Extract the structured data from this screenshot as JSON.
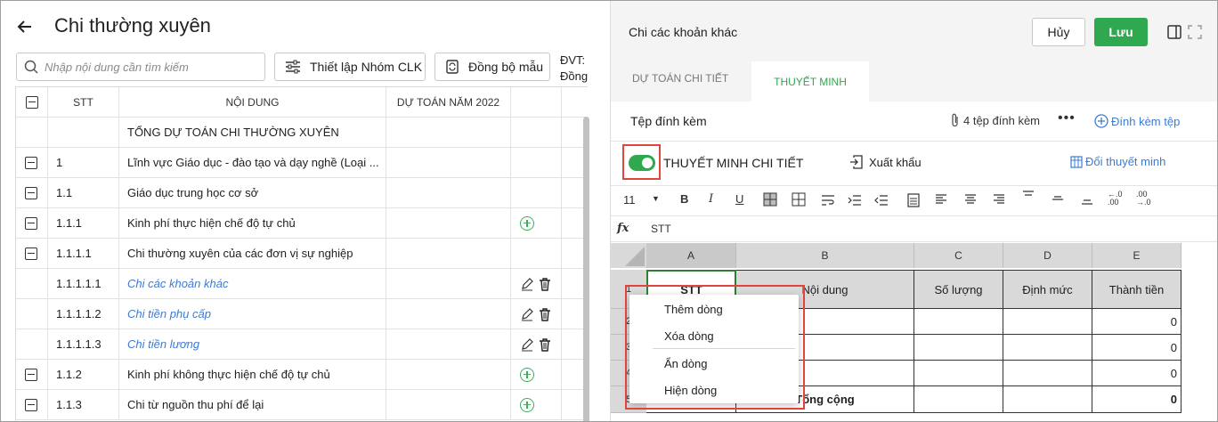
{
  "left": {
    "title": "Chi thường xuyên",
    "search_placeholder": "Nhập nội dung cần tìm kiếm",
    "setup_group_btn": "Thiết lập Nhóm CLK",
    "sync_template_btn": "Đồng bộ mẫu",
    "unit_line1": "ĐVT:",
    "unit_line2": "Đồng",
    "columns": {
      "stt": "STT",
      "content": "NỘI DUNG",
      "budget": "DỰ TOÁN NĂM 2022"
    },
    "rows": [
      {
        "stt": "",
        "content": "TỔNG DỰ TOÁN CHI THƯỜNG XUYÊN",
        "check": false,
        "style": "plain",
        "action": "none"
      },
      {
        "stt": "1",
        "content": "Lĩnh vực Giáo dục - đào tạo và dạy nghề (Loại ...",
        "check": true,
        "style": "plain",
        "action": "none"
      },
      {
        "stt": "1.1",
        "content": "Giáo dục trung học cơ sở",
        "check": true,
        "style": "plain",
        "action": "none"
      },
      {
        "stt": "1.1.1",
        "content": "Kinh phí thực hiện chế độ tự chủ",
        "check": true,
        "style": "plain",
        "action": "add"
      },
      {
        "stt": "1.1.1.1",
        "content": "Chi thường xuyên của các đơn vị sự nghiệp",
        "check": true,
        "style": "plain",
        "action": "none"
      },
      {
        "stt": "1.1.1.1.1",
        "content": "Chi các khoản khác",
        "check": false,
        "style": "link",
        "action": "edit"
      },
      {
        "stt": "1.1.1.1.2",
        "content": "Chi tiền phụ cấp",
        "check": false,
        "style": "link",
        "action": "edit"
      },
      {
        "stt": "1.1.1.1.3",
        "content": "Chi tiền lương",
        "check": false,
        "style": "link",
        "action": "edit"
      },
      {
        "stt": "1.1.2",
        "content": "Kinh phí không thực hiện chế độ tự chủ",
        "check": true,
        "style": "plain",
        "action": "add"
      },
      {
        "stt": "1.1.3",
        "content": "Chi từ nguồn thu phí để lại",
        "check": true,
        "style": "plain",
        "action": "add"
      }
    ]
  },
  "right": {
    "title": "Chi các khoản khác",
    "cancel": "Hủy",
    "save": "Lưu",
    "tabs": [
      "DỰ TOÁN CHI TIẾT",
      "THUYẾT MINH"
    ],
    "active_tab": 1,
    "attach_label": "Tệp đính kèm",
    "attach_count": "4 tệp đính kèm",
    "attach_add": "Đính kèm tệp",
    "detail_label": "THUYẾT MINH CHI TIẾT",
    "detail_enabled": true,
    "export": "Xuất khẩu",
    "change": "Đổi thuyết minh",
    "font_size": "11",
    "formula_value": "STT",
    "sheet": {
      "col_letters": [
        "A",
        "B",
        "C",
        "D",
        "E"
      ],
      "headers": [
        "STT",
        "Nội dung",
        "Số lượng",
        "Định mức",
        "Thành tiền"
      ],
      "row_numbers": [
        "1",
        "2",
        "3",
        "4",
        "5"
      ],
      "values": [
        "0",
        "0",
        "0"
      ],
      "total_label": "Tổng cộng",
      "total_value": "0"
    },
    "context_menu": [
      "Thêm dòng",
      "Xóa dòng",
      "Ẩn dòng",
      "Hiện dòng"
    ]
  },
  "colors": {
    "accent": "#2fa84f",
    "link": "#3d7bd6",
    "highlight": "#e0453b"
  }
}
